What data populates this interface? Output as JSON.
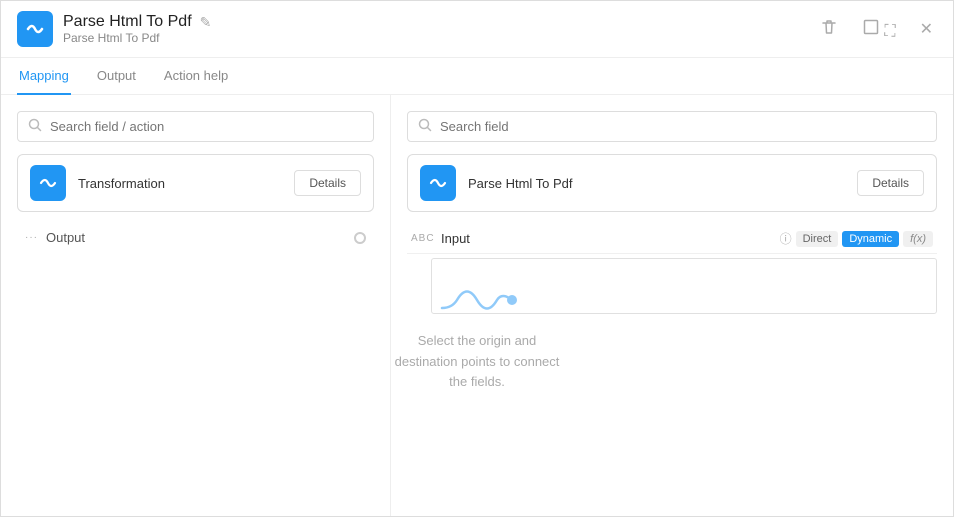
{
  "window": {
    "title": "Parse Html To Pdf",
    "subtitle": "Parse Html To Pdf",
    "edit_icon": "✎"
  },
  "controls": {
    "trash_icon": "🗑",
    "expand_icon": "⤢",
    "close_icon": "✕"
  },
  "tabs": [
    {
      "id": "mapping",
      "label": "Mapping",
      "active": true
    },
    {
      "id": "output",
      "label": "Output",
      "active": false
    },
    {
      "id": "action-help",
      "label": "Action help",
      "active": false
    }
  ],
  "left": {
    "search_placeholder": "Search field / action",
    "block": {
      "label": "Transformation",
      "btn": "Details"
    },
    "output_row": {
      "label": "Output"
    }
  },
  "middle": {
    "hint": "Select the origin and destination points to connect the fields."
  },
  "right": {
    "search_placeholder": "Search field",
    "block": {
      "label": "Parse Html To Pdf",
      "btn": "Details"
    },
    "input_field": {
      "label": "Input",
      "badges": {
        "direct": "Direct",
        "dynamic": "Dynamic",
        "fx": "f(x)"
      }
    }
  }
}
